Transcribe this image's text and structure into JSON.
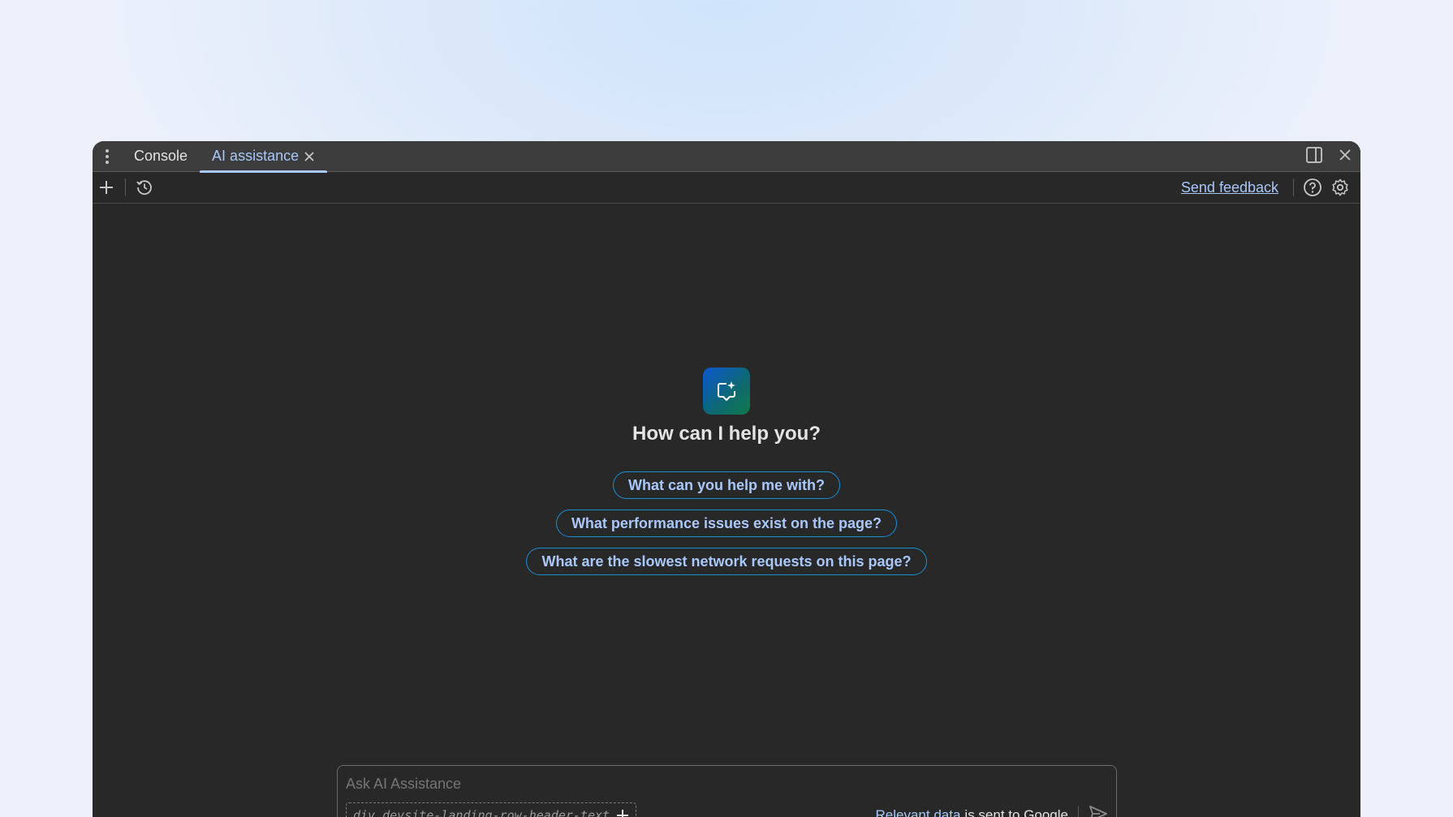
{
  "tabs": [
    {
      "label": "Console"
    },
    {
      "label": "AI assistance"
    }
  ],
  "toolbar": {
    "feedback_label": "Send feedback"
  },
  "main": {
    "greeting": "How can I help you?",
    "suggestions": [
      "What can you help me with?",
      "What performance issues exist on the page?",
      "What are the slowest network requests on this page?"
    ]
  },
  "composer": {
    "placeholder": "Ask AI Assistance",
    "context_selector": "div.devsite-landing-row-header-text",
    "relevant_link": "Relevant data",
    "disclaimer": "is sent to Google"
  },
  "colors": {
    "accent": "#a8c7fa",
    "chip_border": "#1a8fd6",
    "panel_bg": "#282828",
    "tabbar_bg": "#3c3c3c"
  },
  "icons": [
    "more-vert-icon",
    "close-icon",
    "dock-side-icon",
    "plus-icon",
    "history-icon",
    "help-icon",
    "settings-icon",
    "ai-logo-icon",
    "send-icon"
  ]
}
